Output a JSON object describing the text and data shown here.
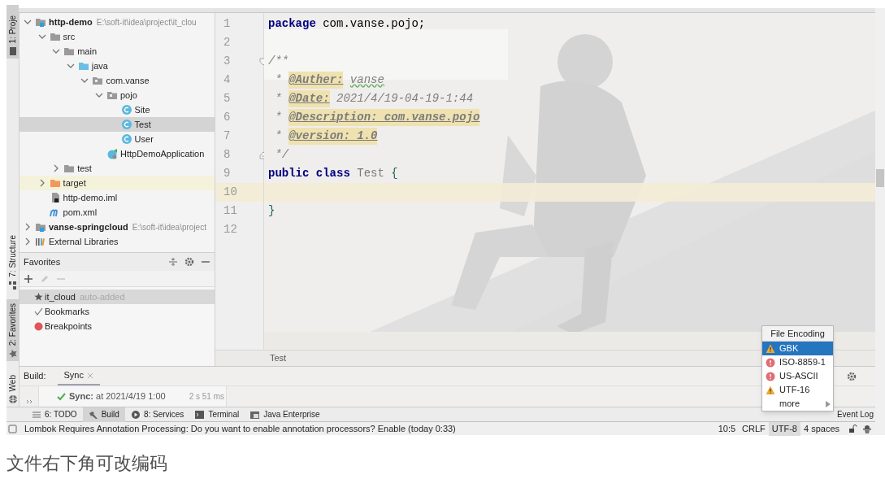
{
  "tool_strip": [
    {
      "label": "1: Proje",
      "kind": "project",
      "selected": true
    },
    {
      "label": "7: Structure",
      "kind": "structure",
      "selected": false
    },
    {
      "label": "2: Favorites",
      "kind": "favorites",
      "selected": true
    },
    {
      "label": "Web",
      "kind": "web",
      "selected": false
    }
  ],
  "project_tree": [
    {
      "label": "http-demo",
      "path": "E:\\soft-it\\idea\\project\\it_clou",
      "kind": "module",
      "expanded": true,
      "selected": false,
      "highlighted": false,
      "children": [
        {
          "label": "src",
          "kind": "folder",
          "expanded": true,
          "selected": false,
          "highlighted": false,
          "children": [
            {
              "label": "main",
              "kind": "folder",
              "expanded": true,
              "selected": false,
              "highlighted": false,
              "children": [
                {
                  "label": "java",
                  "kind": "source",
                  "expanded": true,
                  "selected": false,
                  "highlighted": false,
                  "children": [
                    {
                      "label": "com.vanse",
                      "kind": "package",
                      "expanded": true,
                      "selected": false,
                      "highlighted": false,
                      "children": [
                        {
                          "label": "pojo",
                          "kind": "package",
                          "expanded": true,
                          "selected": false,
                          "highlighted": false,
                          "children": [
                            {
                              "label": "Site",
                              "kind": "class",
                              "selected": false,
                              "highlighted": false
                            },
                            {
                              "label": "Test",
                              "kind": "class",
                              "selected": true,
                              "highlighted": false
                            },
                            {
                              "label": "User",
                              "kind": "class",
                              "selected": false,
                              "highlighted": false
                            }
                          ]
                        },
                        {
                          "label": "HttpDemoApplication",
                          "kind": "app",
                          "selected": false,
                          "highlighted": false
                        }
                      ]
                    }
                  ]
                }
              ]
            },
            {
              "label": "test",
              "kind": "folder",
              "expanded": false,
              "selected": false,
              "highlighted": false
            }
          ]
        },
        {
          "label": "target",
          "kind": "excluded",
          "expanded": false,
          "selected": false,
          "highlighted": true
        },
        {
          "label": "http-demo.iml",
          "kind": "iml",
          "selected": false,
          "highlighted": false
        },
        {
          "label": "pom.xml",
          "kind": "maven",
          "selected": false,
          "highlighted": false
        }
      ]
    },
    {
      "label": "vanse-springcloud",
      "path": "E:\\soft-it\\idea\\project",
      "kind": "module",
      "expanded": false,
      "selected": false,
      "highlighted": false
    },
    {
      "label": "External Libraries",
      "kind": "libraries",
      "expanded": false,
      "selected": false,
      "highlighted": false
    }
  ],
  "favorites": {
    "title": "Favorites",
    "items": [
      {
        "label": "it_cloud",
        "hint": "auto-added",
        "kind": "star",
        "selected": true
      },
      {
        "label": "Bookmarks",
        "kind": "check",
        "selected": false
      },
      {
        "label": "Breakpoints",
        "kind": "breakpoint",
        "selected": false
      }
    ]
  },
  "editor": {
    "breadcrumb": "Test",
    "lines": [
      {
        "number": "1",
        "current": false,
        "tokens": [
          {
            "text": "package",
            "kind": "keyword"
          },
          {
            "text": " com.vanse.pojo;",
            "kind": "plain"
          }
        ]
      },
      {
        "number": "2",
        "current": false
      },
      {
        "number": "3",
        "current": false,
        "fold_start": true,
        "tokens": [
          {
            "text": "/**",
            "kind": "comment"
          }
        ]
      },
      {
        "number": "4",
        "current": false,
        "tokens": [
          {
            "text": " * ",
            "kind": "comment"
          },
          {
            "text": "@Auther:",
            "kind": "doctag"
          },
          {
            "text": " vanse",
            "kind": "typo"
          }
        ]
      },
      {
        "number": "5",
        "current": false,
        "tokens": [
          {
            "text": " * ",
            "kind": "comment"
          },
          {
            "text": "@Date:",
            "kind": "doctag"
          },
          {
            "text": " 2021/4/19-04-19-1:44",
            "kind": "comment"
          }
        ]
      },
      {
        "number": "6",
        "current": false,
        "tokens": [
          {
            "text": " * ",
            "kind": "comment"
          },
          {
            "text": "@Description: com.vanse.pojo",
            "kind": "doctag"
          }
        ]
      },
      {
        "number": "7",
        "current": false,
        "tokens": [
          {
            "text": " * ",
            "kind": "comment"
          },
          {
            "text": "@version: 1.0",
            "kind": "doctag"
          }
        ]
      },
      {
        "number": "8",
        "current": false,
        "fold_end": true,
        "tokens": [
          {
            "text": " */",
            "kind": "comment"
          }
        ]
      },
      {
        "number": "9",
        "current": false,
        "tokens": [
          {
            "text": "public class",
            "kind": "keyword"
          },
          {
            "text": " Test ",
            "kind": "unused"
          },
          {
            "text": "{",
            "kind": "brace"
          }
        ]
      },
      {
        "number": "10",
        "current": true
      },
      {
        "number": "11",
        "current": false,
        "tokens": [
          {
            "text": "}",
            "kind": "brace"
          }
        ]
      },
      {
        "number": "12",
        "current": false
      }
    ]
  },
  "build": {
    "label": "Build:",
    "tabs": [
      {
        "label": "Sync",
        "selected": true
      }
    ],
    "sync": {
      "text": "**Sync:** at 2021/4/19 1:00",
      "duration": "2 s 51 ms"
    }
  },
  "tool_windows": [
    {
      "label": "6: TODO",
      "kind": "todo",
      "selected": false
    },
    {
      "label": "Build",
      "kind": "build",
      "selected": true
    },
    {
      "label": "8: Services",
      "kind": "services",
      "selected": false
    },
    {
      "label": "Terminal",
      "kind": "terminal",
      "selected": false
    },
    {
      "label": "Java Enterprise",
      "kind": "enterprise",
      "selected": false
    }
  ],
  "event_log": "Event Log",
  "status_bar": {
    "message": "Lombok Requires Annotation Processing: Do you want to enable annotation processors? Enable (today 0:33)",
    "items": [
      {
        "label": "10:5",
        "selected": false
      },
      {
        "label": "CRLF",
        "selected": false
      },
      {
        "label": "UTF-8",
        "selected": true
      },
      {
        "label": "4 spaces",
        "selected": false
      }
    ]
  },
  "encoding_popup": {
    "title": "File Encoding",
    "items": [
      {
        "label": "GBK",
        "kind": "warning",
        "selected": true
      },
      {
        "label": "ISO-8859-1",
        "kind": "error",
        "selected": false
      },
      {
        "label": "US-ASCII",
        "kind": "error",
        "selected": false
      },
      {
        "label": "UTF-16",
        "kind": "warning",
        "selected": false
      },
      {
        "label": "more",
        "kind": "submenu",
        "selected": false
      }
    ]
  },
  "caption": "文件右下角可改编码"
}
